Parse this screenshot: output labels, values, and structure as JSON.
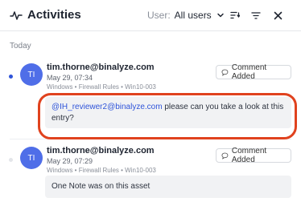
{
  "header": {
    "title": "Activities",
    "user_filter_label": "User:",
    "user_filter_value": "All users"
  },
  "section": {
    "label": "Today"
  },
  "entries": [
    {
      "initials": "TI",
      "user": "tim.thorne@binalyze.com",
      "date": "May 29, 07:34",
      "context": "Windows • Firewall Rules • Win10-003",
      "badge": "Comment Added",
      "mention": "@IH_reviewer2@binalyze.com",
      "comment": " please can you take a look at this entry?",
      "unread": true
    },
    {
      "initials": "TI",
      "user": "tim.thorne@binalyze.com",
      "date": "May 29, 07:29",
      "context": "Windows • Firewall Rules • Win10-003",
      "badge": "Comment Added",
      "comment": "One Note was on this asset",
      "unread": false
    }
  ],
  "colors": {
    "accent": "#2f54d9",
    "avatar": "#4f6ee8",
    "highlight": "#e0421e"
  },
  "icons": {
    "title": "activity-pulse-icon",
    "user_filter": "chevron-down-icon",
    "sort": "sort-icon",
    "filter": "filter-icon",
    "close": "close-icon",
    "badge": "comment-bubble-icon"
  }
}
